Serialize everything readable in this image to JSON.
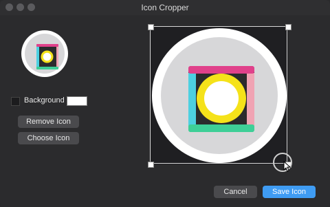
{
  "window": {
    "title": "Icon Cropper"
  },
  "sidebar": {
    "background_label": "Background",
    "background_enabled": false,
    "background_color": "#ffffff",
    "remove_label": "Remove Icon",
    "choose_label": "Choose Icon"
  },
  "footer": {
    "cancel_label": "Cancel",
    "save_label": "Save Icon"
  },
  "colors": {
    "accent": "#3f9cf3",
    "icon_top_bar": "#e0418b",
    "icon_right_bar": "#f0a3b3",
    "icon_bottom_bar": "#3ecf97",
    "icon_left_bar": "#4dd0e1",
    "icon_ring": "#f5e21a",
    "icon_dark": "#2b2b2d"
  },
  "icons": [
    "close-icon",
    "minimize-icon",
    "maximize-icon",
    "app-icon",
    "resize-cursor-icon"
  ]
}
